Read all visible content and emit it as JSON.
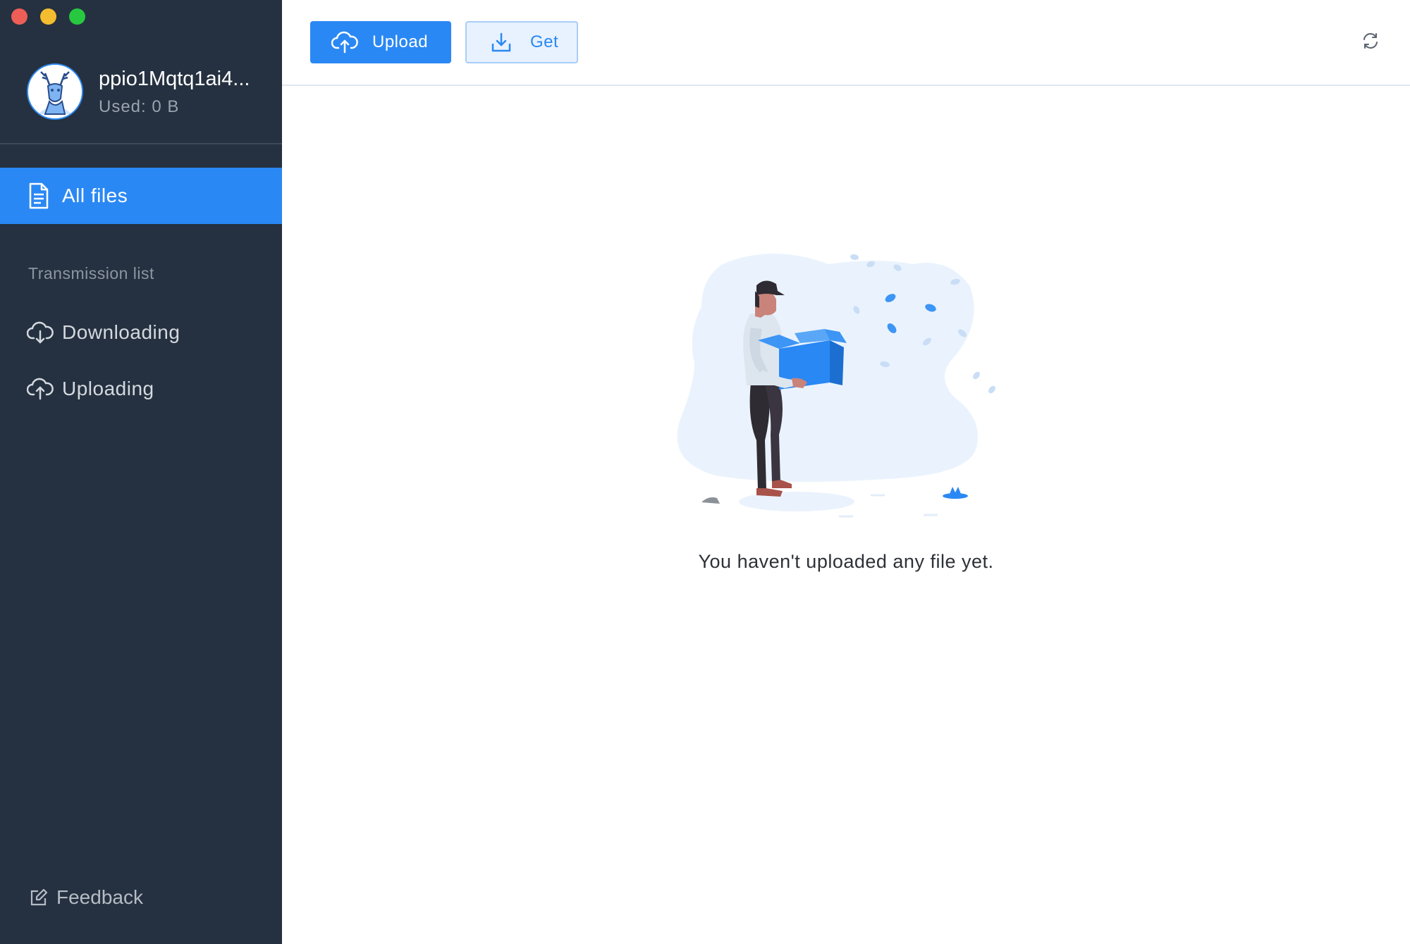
{
  "window": {
    "traffic_lights": [
      "close",
      "minimize",
      "maximize"
    ]
  },
  "profile": {
    "username": "ppio1Mqtq1ai4...",
    "used": "Used: 0 B",
    "avatar_icon": "deer-avatar-icon"
  },
  "sidebar": {
    "all_files_label": "All files",
    "section_title": "Transmission list",
    "downloading_label": "Downloading",
    "uploading_label": "Uploading",
    "feedback_label": "Feedback"
  },
  "toolbar": {
    "upload_label": "Upload",
    "get_label": "Get",
    "refresh_icon": "refresh-icon"
  },
  "main": {
    "empty_message": "You haven't uploaded any file yet."
  },
  "colors": {
    "sidebar_bg": "#253140",
    "accent": "#2a88f4",
    "active_nav": "#2a88f4"
  }
}
